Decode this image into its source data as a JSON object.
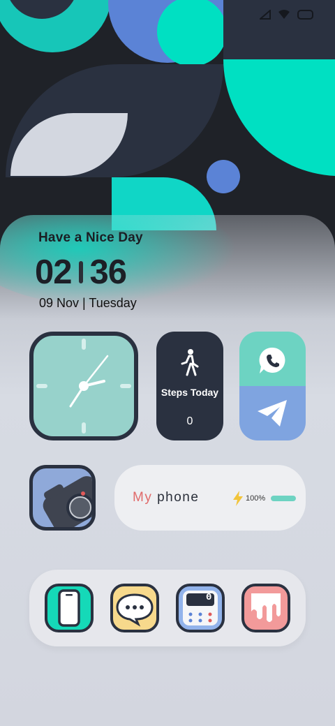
{
  "status_bar": {
    "icons": [
      "signal-icon",
      "wifi-icon",
      "battery-icon"
    ]
  },
  "clock_widget": {
    "greeting": "Have a Nice Day",
    "hours": "02",
    "minutes": "36",
    "date": "09 Nov | Tuesday"
  },
  "widgets": {
    "steps": {
      "label": "Steps Today",
      "value": "0",
      "icon": "walking-person-icon"
    },
    "communication": {
      "top_icon": "phone-chat-icon",
      "bottom_icon": "paper-plane-icon"
    },
    "camera": {
      "icon": "camera-icon"
    },
    "my_phone": {
      "title_prefix": "My",
      "title_suffix": "phone",
      "battery_label": "100%",
      "battery_level": 1.0,
      "icon": "lightning-icon"
    }
  },
  "dock": {
    "apps": [
      {
        "name": "phone-app",
        "icon": "smartphone-icon",
        "color": "#15d9b8"
      },
      {
        "name": "messages-app",
        "icon": "chat-bubble-icon",
        "color": "#f7d98c"
      },
      {
        "name": "calculator-app",
        "icon": "calculator-icon",
        "color": "#92b3eb",
        "display_value": "0"
      },
      {
        "name": "gallery-app",
        "icon": "gallery-icon",
        "color": "#f29a9a"
      }
    ]
  },
  "colors": {
    "accent_teal": "#00e0c2",
    "navy": "#2a3140",
    "wallpaper_blue": "#5b83d6",
    "wallpaper_light": "#d3d7e0"
  }
}
